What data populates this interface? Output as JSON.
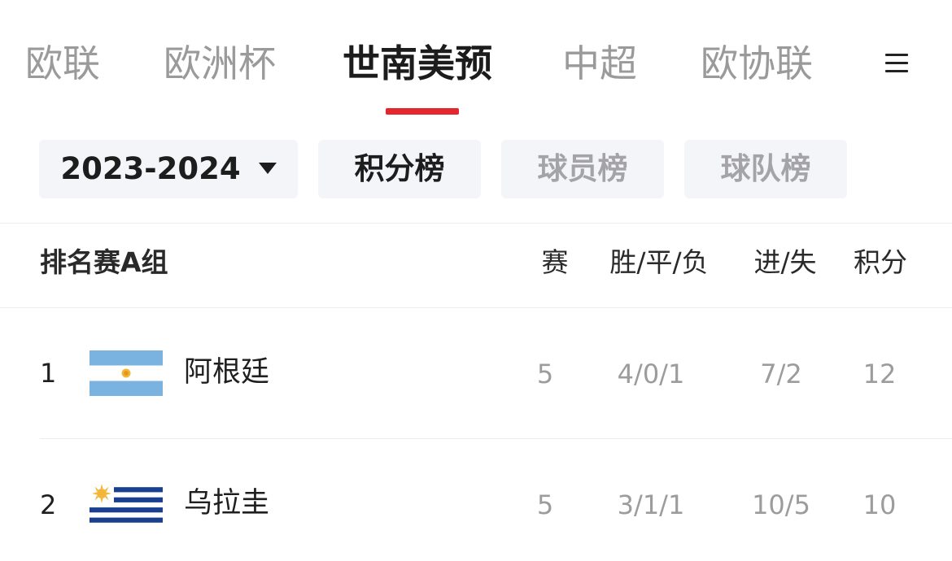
{
  "tabs": [
    {
      "label": "欧联",
      "active": false
    },
    {
      "label": "欧洲杯",
      "active": false
    },
    {
      "label": "世南美预",
      "active": true
    },
    {
      "label": "中超",
      "active": false
    },
    {
      "label": "欧协联",
      "active": false
    }
  ],
  "menu_icon": "hamburger-menu-icon",
  "accent_color": "#e5262f",
  "filters": {
    "season": "2023-2024",
    "standings": "积分榜",
    "players": "球员榜",
    "teams": "球队榜"
  },
  "table": {
    "group_title": "排名赛A组",
    "columns": {
      "played": "赛",
      "wdl": "胜/平/负",
      "gfga": "进/失",
      "points": "积分"
    },
    "rows": [
      {
        "rank": "1",
        "team": "阿根廷",
        "flag": "argentina-flag-icon",
        "played": "5",
        "wdl": "4/0/1",
        "gfga": "7/2",
        "points": "12"
      },
      {
        "rank": "2",
        "team": "乌拉圭",
        "flag": "uruguay-flag-icon",
        "played": "5",
        "wdl": "3/1/1",
        "gfga": "10/5",
        "points": "10"
      }
    ]
  }
}
